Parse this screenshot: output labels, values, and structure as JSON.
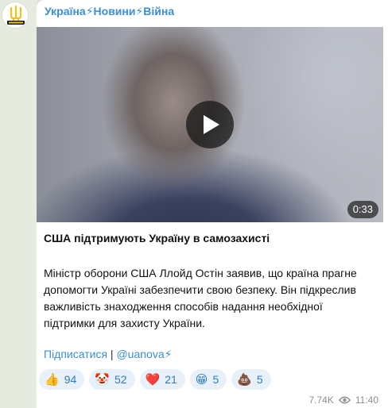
{
  "channel": {
    "name": "Україна⚡Новини⚡Війна",
    "avatar_text": "УКРАЇНА НОВИНИ"
  },
  "video": {
    "duration": "0:33",
    "play_icon": "play-icon"
  },
  "post": {
    "title": "США підтримують Україну в самозахисті",
    "body": "Міністр оборони США Ллойд Остін заявив, що країна прагне\nдопомогти Україні забезпечити свою безпеку. Він підкреслив\nважливість знаходження способів надання необхідної\nпідтримки для захисту України.",
    "subscribe_label": "Підписатися",
    "separator": " | ",
    "handle": "@uanova⚡"
  },
  "reactions": [
    {
      "emoji": "👍",
      "count": "94"
    },
    {
      "emoji": "🤡",
      "count": "52"
    },
    {
      "emoji": "❤️",
      "count": "21"
    },
    {
      "emoji": "😁",
      "count": "5"
    },
    {
      "emoji": "💩",
      "count": "5"
    }
  ],
  "footer": {
    "views": "7.74K",
    "views_icon": "eye-icon",
    "time": "11:40"
  },
  "colors": {
    "accent": "#3a8fd6",
    "reaction_bg": "#e8f1fa",
    "chat_bg": "#dfe5d6",
    "avatar_yellow": "#f2c018"
  }
}
